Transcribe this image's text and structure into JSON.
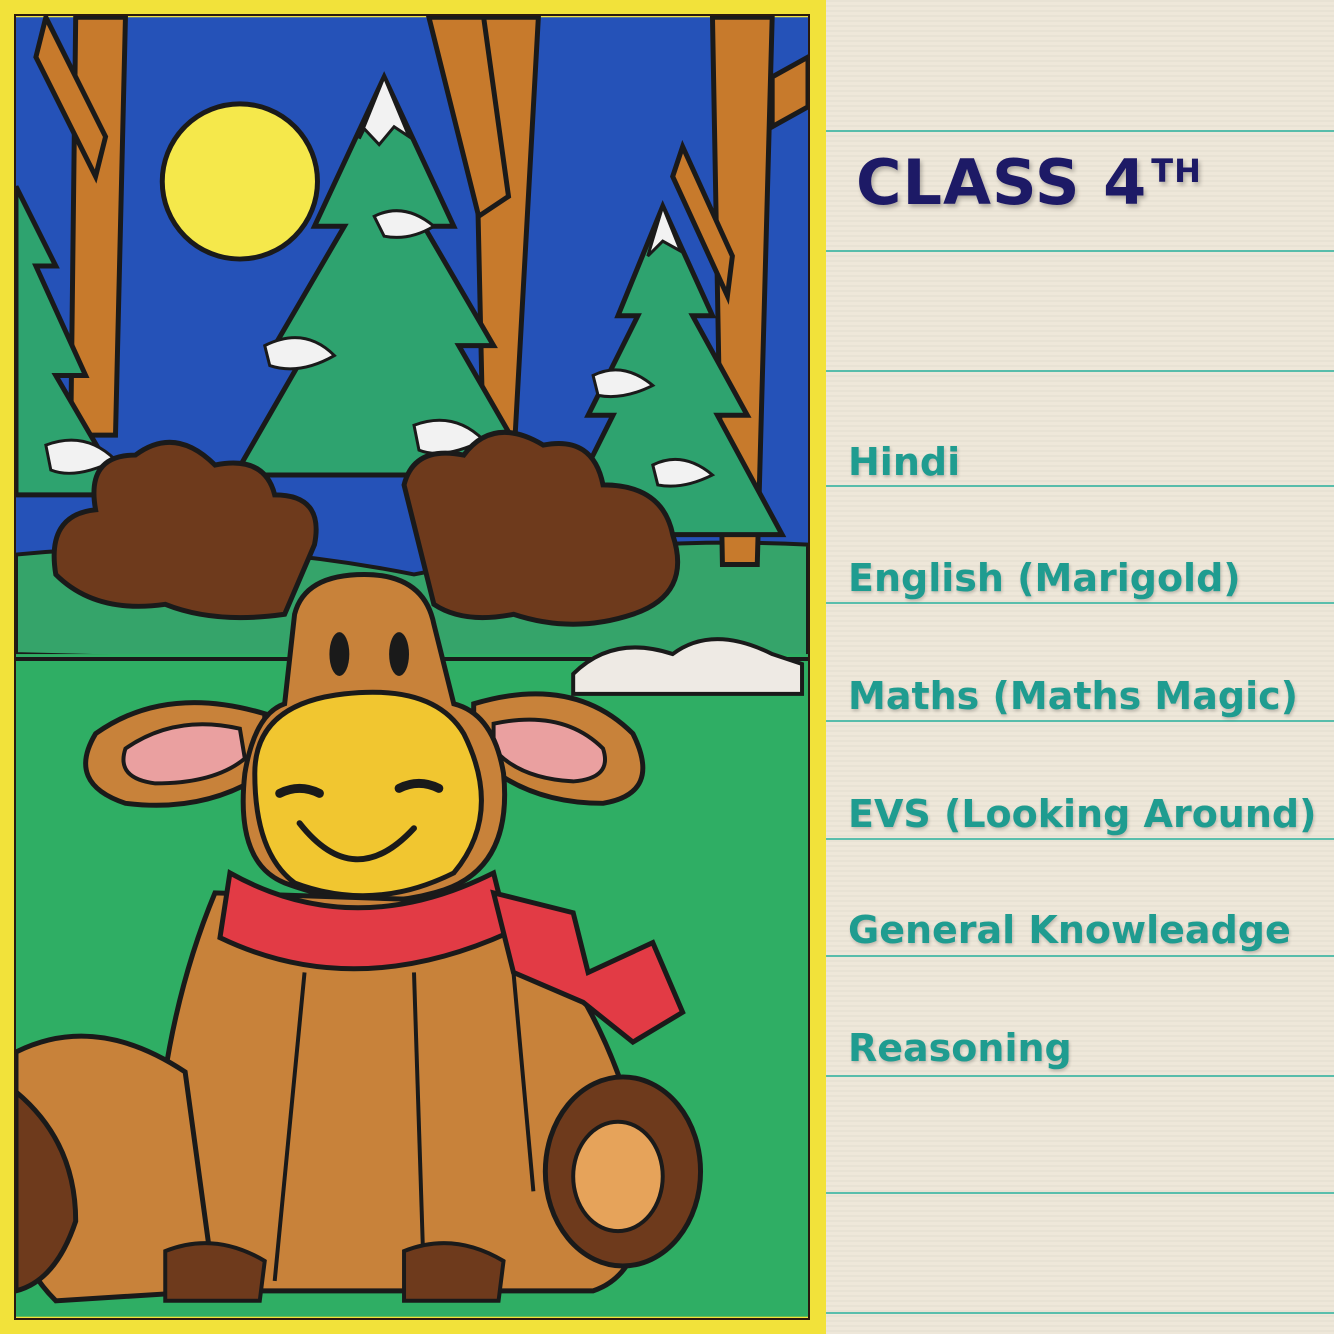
{
  "header": {
    "title": "CLASS 4",
    "title_sup": "TH"
  },
  "subjects": [
    "Hindi",
    "English (Marigold)",
    "Maths (Maths Magic)",
    "EVS (Looking Around)",
    "General Knowleadge",
    "Reasoning"
  ],
  "colors": {
    "frame": "#f2e23a",
    "title": "#1d1a66",
    "subject": "#1f9c90",
    "rule": "#3fb6a3",
    "sky": "#2552b8",
    "grass": "#2fae64",
    "moose": "#c8823a",
    "scarf": "#e23b45"
  },
  "illustration": {
    "icon": "moose-illustration"
  }
}
